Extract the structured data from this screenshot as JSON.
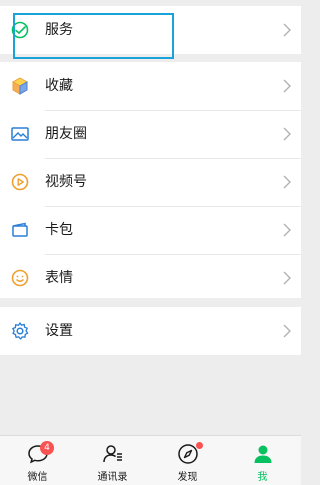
{
  "menu": {
    "service": {
      "label": "服务",
      "icon": "service-icon"
    },
    "favorites": {
      "label": "收藏",
      "icon": "cube-icon"
    },
    "moments": {
      "label": "朋友圈",
      "icon": "image-icon"
    },
    "channels": {
      "label": "视频号",
      "icon": "play-icon"
    },
    "cards": {
      "label": "卡包",
      "icon": "wallet-icon"
    },
    "stickers": {
      "label": "表情",
      "icon": "smiley-icon"
    },
    "settings": {
      "label": "设置",
      "icon": "gear-icon"
    }
  },
  "tabbar": {
    "chats": {
      "label": "微信",
      "badge": "4"
    },
    "contacts": {
      "label": "通讯录"
    },
    "discover": {
      "label": "发现"
    },
    "me": {
      "label": "我"
    }
  },
  "colors": {
    "accent": "#07c160",
    "highlight_box": "#1aa3d9",
    "badge": "#fa5151"
  }
}
